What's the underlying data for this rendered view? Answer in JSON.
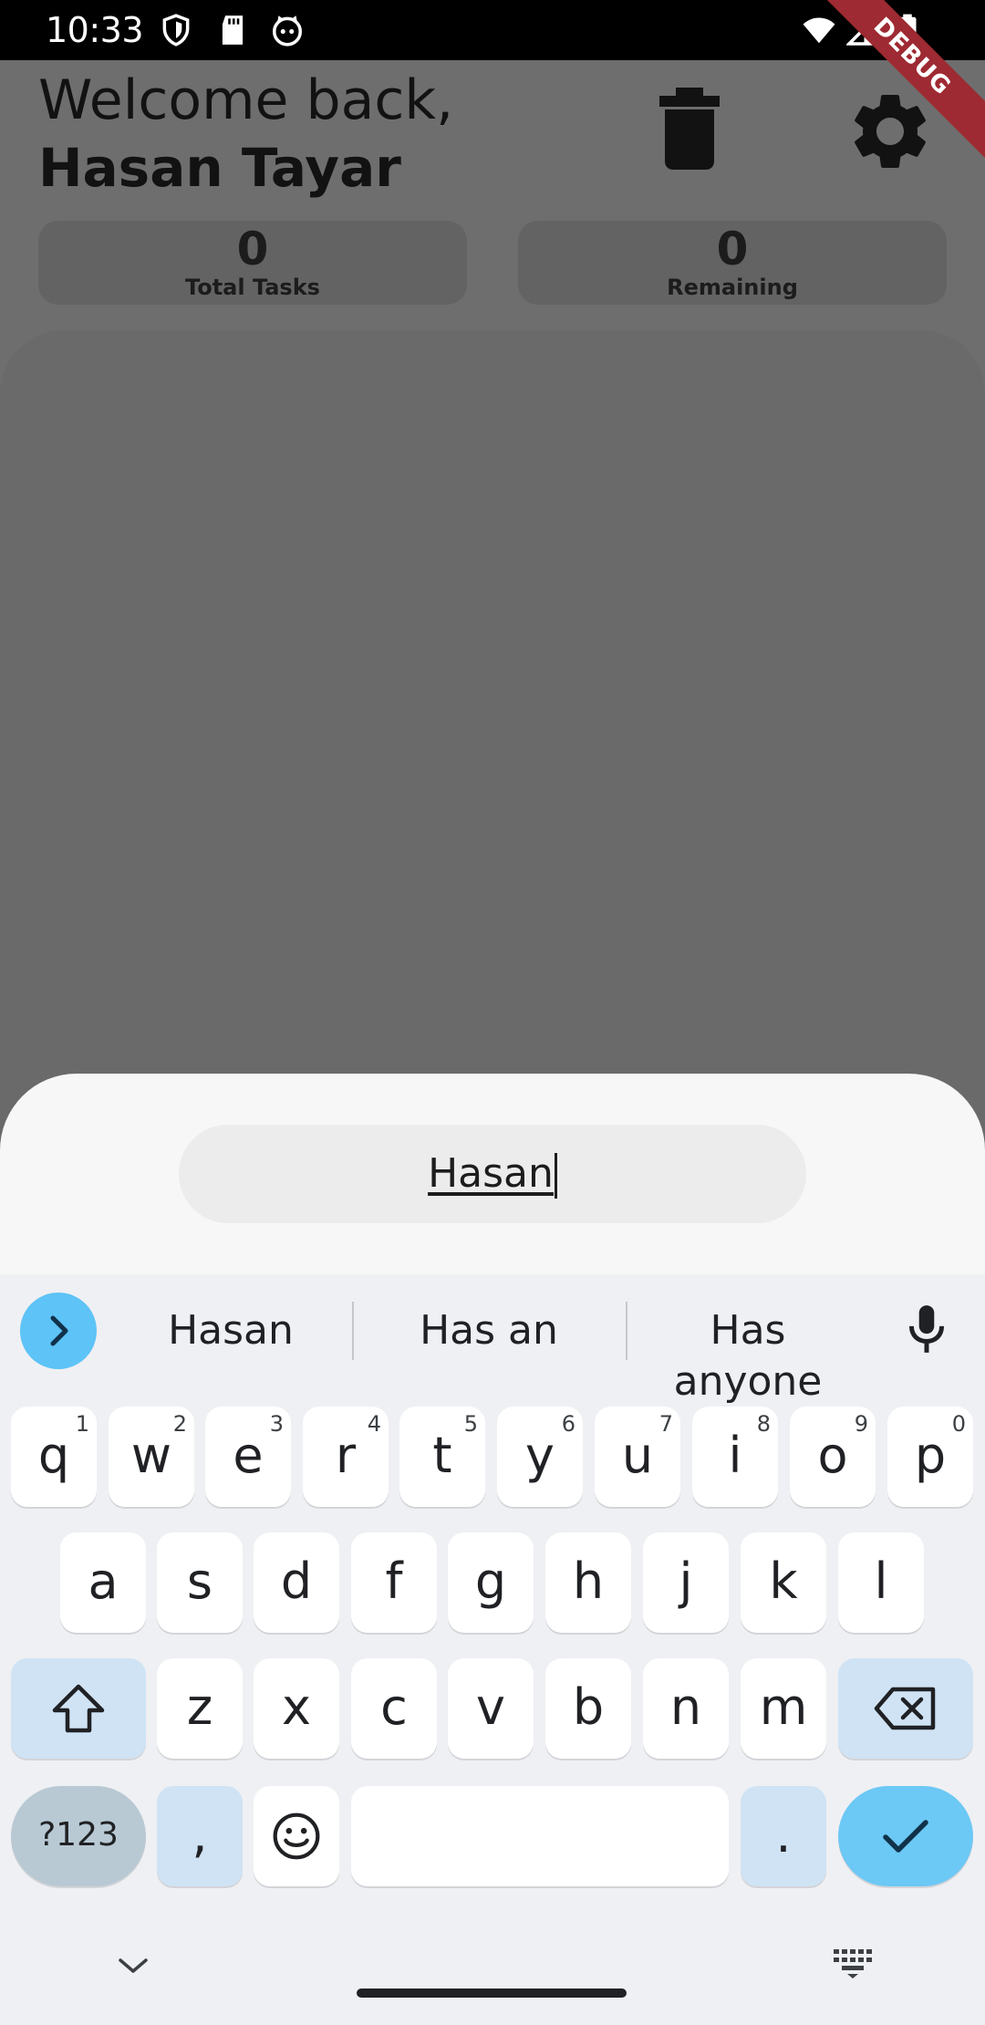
{
  "status_bar": {
    "time": "10:33",
    "left_icons": [
      "shield-icon",
      "sd-card-icon",
      "cat-face-icon"
    ],
    "right_icons": [
      "wifi-icon",
      "signal-icon",
      "battery-icon"
    ],
    "debug_banner": "DEBUG"
  },
  "header": {
    "greeting": "Welcome back,",
    "user_name": "Hasan Tayar",
    "actions": [
      "trash-icon",
      "gear-icon"
    ]
  },
  "stats": [
    {
      "value": "0",
      "label": "Total Tasks"
    },
    {
      "value": "0",
      "label": "Remaining"
    }
  ],
  "sheet": {
    "input_value": "Hasan"
  },
  "keyboard": {
    "suggestions": [
      "Hasan",
      "Has an",
      "Has anyone"
    ],
    "row1": [
      {
        "key": "q",
        "num": "1"
      },
      {
        "key": "w",
        "num": "2"
      },
      {
        "key": "e",
        "num": "3"
      },
      {
        "key": "r",
        "num": "4"
      },
      {
        "key": "t",
        "num": "5"
      },
      {
        "key": "y",
        "num": "6"
      },
      {
        "key": "u",
        "num": "7"
      },
      {
        "key": "i",
        "num": "8"
      },
      {
        "key": "o",
        "num": "9"
      },
      {
        "key": "p",
        "num": "0"
      }
    ],
    "row2": [
      "a",
      "s",
      "d",
      "f",
      "g",
      "h",
      "j",
      "k",
      "l"
    ],
    "row3": [
      "z",
      "x",
      "c",
      "v",
      "b",
      "n",
      "m"
    ],
    "symbols_label": "?123",
    "comma": ",",
    "period": ".",
    "colors": {
      "accent": "#5ec3f6",
      "function_key": "#cfe3f4",
      "symbol_key": "#b8c9d4"
    }
  }
}
